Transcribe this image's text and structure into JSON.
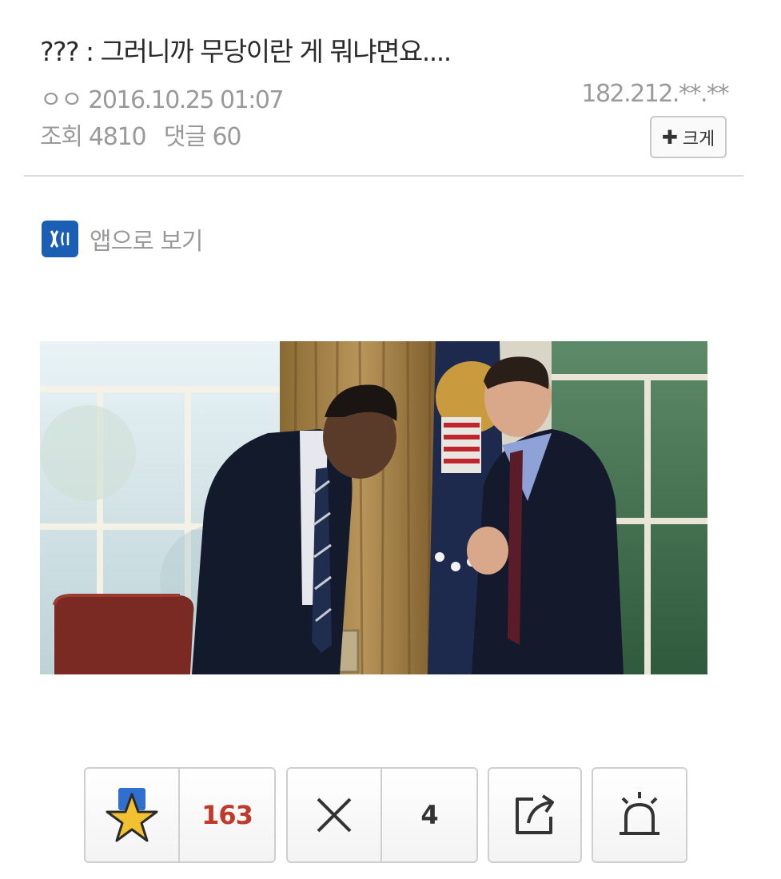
{
  "post": {
    "title": "??? : 그러니까 무당이란 게 뭐냐면요....",
    "author": "ㅇㅇ",
    "datetime": "2016.10.25 01:07",
    "ip": "182.212.**.**",
    "views_label": "조회",
    "views": "4810",
    "comments_label": "댓글",
    "comments": "60",
    "enlarge_label": "크게"
  },
  "app_link": {
    "label": "앱으로 보기"
  },
  "actions": {
    "recommend_count": "163",
    "dislike_count": "4"
  },
  "colors": {
    "accent_red": "#c0392b",
    "app_icon_blue": "#1a5fb4",
    "muted_text": "#9a9a9a"
  },
  "icons": [
    "app-logo-icon",
    "star-icon",
    "close-icon",
    "share-icon",
    "siren-icon",
    "plus-icon"
  ]
}
